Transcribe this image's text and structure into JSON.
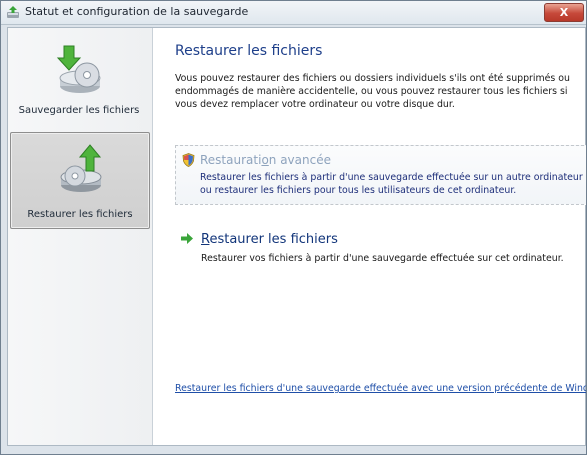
{
  "window": {
    "title": "Statut et configuration de la sauvegarde",
    "close_label": "X"
  },
  "sidebar": {
    "items": [
      {
        "label": "Sauvegarder les fichiers",
        "icon": "backup-disc-icon",
        "selected": false
      },
      {
        "label": "Restaurer les fichiers",
        "icon": "restore-disc-icon",
        "selected": true
      }
    ]
  },
  "main": {
    "title": "Restaurer les fichiers",
    "intro": "Vous pouvez restaurer des fichiers ou dossiers individuels s'ils ont été supprimés ou endommagés de manière accidentelle, ou vous pouvez restaurer tous les fichiers si vous devez remplacer votre ordinateur ou votre disque dur.",
    "advanced": {
      "title_before": "Restaurati",
      "title_accel": "o",
      "title_after": "n avancée",
      "icon": "shield-icon",
      "description": "Restaurer les fichiers à partir d'une sauvegarde effectuée sur un autre ordinateur ou restaurer les fichiers pour tous les utilisateurs de cet ordinateur."
    },
    "restore": {
      "title_accel": "R",
      "title_after": "estaurer les fichiers",
      "icon": "green-arrow-icon",
      "description": "Restaurer vos fichiers à partir d'une sauvegarde effectuée sur cet ordinateur."
    },
    "previous_version_link": "Restaurer les fichiers d'une sauvegarde effectuée avec une version précédente de Windows"
  },
  "colors": {
    "title_blue": "#1e3f8a",
    "link_blue": "#1f4fa8",
    "disabled_title": "#8ea3bd",
    "selected_bg": "#d3d3d3"
  }
}
